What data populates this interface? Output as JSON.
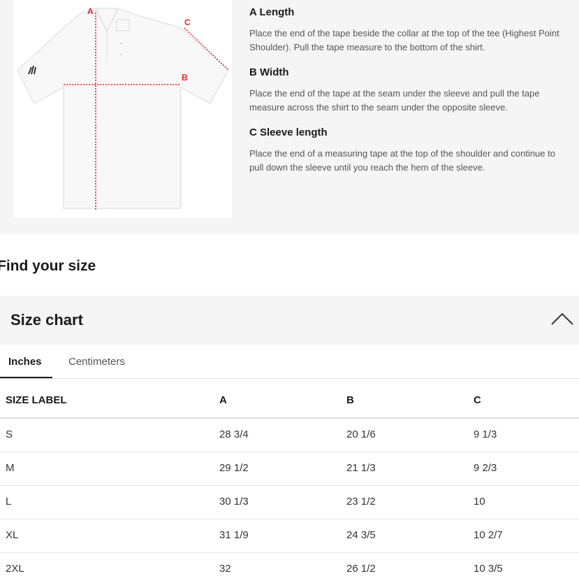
{
  "guide": {
    "diagram_labels": {
      "a": "A",
      "b": "B",
      "c": "C"
    },
    "colors": {
      "measure_line": "#e02424"
    },
    "items": [
      {
        "title": "A Length",
        "text": "Place the end of the tape beside the collar at the top of the tee (Highest Point Shoulder). Pull the tape measure to the bottom of the shirt."
      },
      {
        "title": "B Width",
        "text": "Place the end of the tape at the seam under the sleeve and pull the tape measure across the shirt to the seam under the opposite sleeve."
      },
      {
        "title": "C Sleeve length",
        "text": "Place the end of a measuring tape at the top of the shoulder and continue to pull down the sleeve until you reach the hem of the sleeve."
      }
    ]
  },
  "find_size": {
    "title": "Find your size"
  },
  "size_chart": {
    "title": "Size chart",
    "toggle_icon": "chevron-up-icon",
    "tabs": [
      {
        "label": "Inches",
        "active": true
      },
      {
        "label": "Centimeters",
        "active": false
      }
    ],
    "columns": [
      "SIZE LABEL",
      "A",
      "B",
      "C"
    ],
    "rows": [
      [
        "S",
        "28 3/4",
        "20 1/6",
        "9 1/3"
      ],
      [
        "M",
        "29 1/2",
        "21 1/3",
        "9 2/3"
      ],
      [
        "L",
        "30 1/3",
        "23 1/2",
        "10"
      ],
      [
        "XL",
        "31 1/9",
        "24 3/5",
        "10 2/7"
      ],
      [
        "2XL",
        "32",
        "26 1/2",
        "10 3/5"
      ]
    ]
  }
}
